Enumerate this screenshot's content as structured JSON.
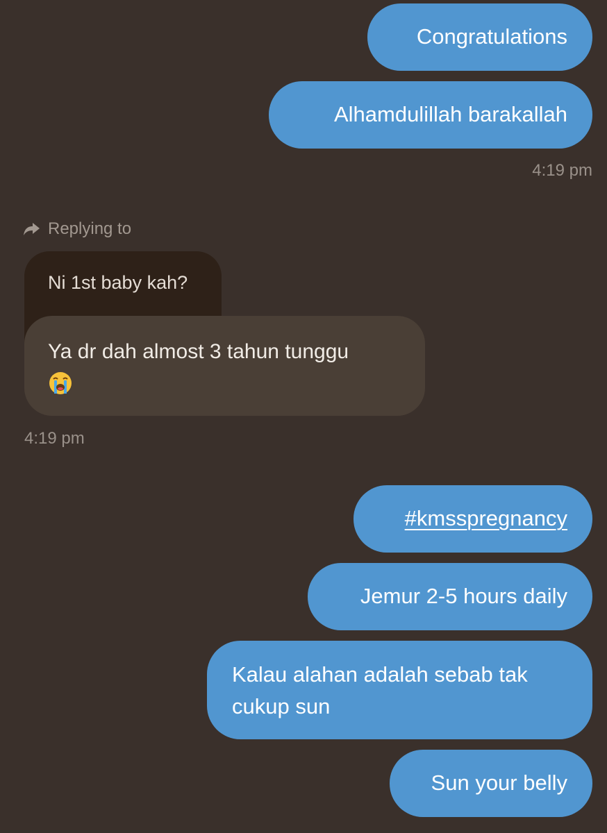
{
  "messages": {
    "m1": "Congratulations",
    "m2": "Alhamdulillah barakallah",
    "time1": "4:19 pm",
    "replying_label": "Replying to",
    "quoted": "Ni 1st baby kah?",
    "reply_text": "Ya dr dah almost 3 tahun tunggu",
    "reply_emoji": "loudly-crying-face-icon",
    "time2": "4:19 pm",
    "m3": "#kmsspregnancy",
    "m4": "Jemur 2-5 hours daily",
    "m5": "Kalau alahan adalah sebab tak cukup sun",
    "m6": "Sun your belly"
  },
  "colors": {
    "background": "#3a302b",
    "sent_bubble": "#5196d0",
    "received_bubble": "#4a3f36",
    "quote_bubble": "#2e2118",
    "timestamp": "#9a918a"
  }
}
